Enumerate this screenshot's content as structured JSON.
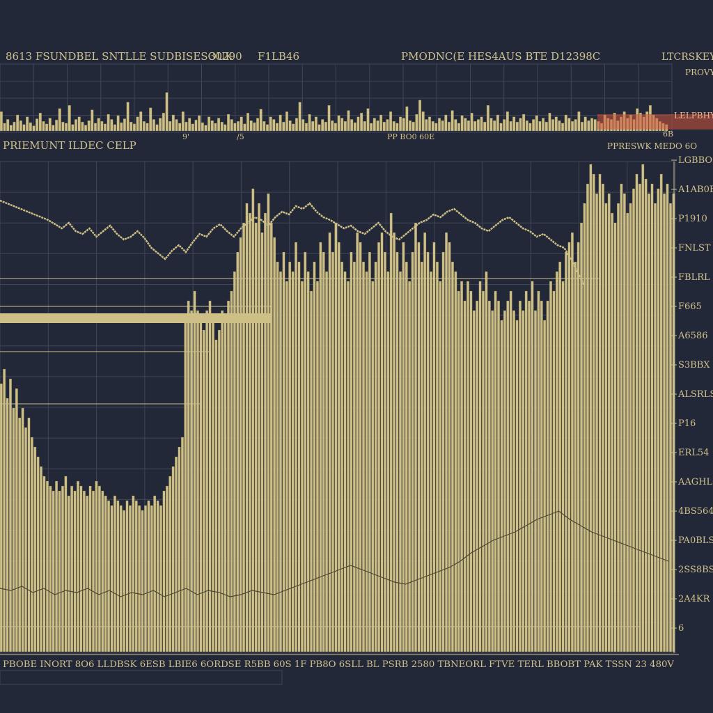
{
  "header": {
    "left": "8613 FSUNDBEL SNTLLE  SUDBISESOUK",
    "center_left": "30290",
    "center_mid": "F1LB46",
    "center_right": "PMODNC(E  HES4AUS  BTE  D12398C",
    "right": "LTCRSKEY"
  },
  "upper_panel": {
    "bottom_labels": [
      "9'",
      "/5",
      "PP BO0 60E",
      "6B"
    ],
    "right_labels": [
      "PROVY",
      "LELPBHY"
    ],
    "section_title": "PRIEMUNT ILDEC CELP",
    "section_right": "PPRESWK MEDO 6O"
  },
  "price_axis": {
    "labels": [
      "LGBBO",
      "A1AB0B",
      "P1910",
      "FNLST",
      "FBLRL",
      "F665",
      "A6586",
      "S3BBX",
      "ALSRLS",
      "P16",
      "ERL54",
      "AAGHLC",
      "4BS564",
      "PA0BLS",
      "2SS8BS",
      "2A4KR",
      "6"
    ]
  },
  "bottom_labels": "PBOBE INORT 8O6  LLDBSK 6ESB LBIE6 6ORDSE  R5BB 60S 1F PB8O  6SLL BL  PSRB 2580  TBNEORL  FTVE  TERL BBOBT  PAK  TSSN 23 480V",
  "colors": {
    "background": "#232838",
    "bar": "#cdbf86",
    "bar_edge": "#6f6848",
    "grid": "#3f4659",
    "text": "#cfc28f",
    "accent_red": "#d0543a"
  },
  "chart_data": [
    {
      "type": "bar",
      "title": "",
      "xlabel": "",
      "ylabel": "",
      "ylim": [
        0,
        100
      ],
      "bar_count": 220,
      "grid": true,
      "values": [
        30,
        12,
        18,
        9,
        14,
        25,
        16,
        10,
        22,
        13,
        8,
        19,
        28,
        15,
        11,
        20,
        9,
        17,
        35,
        14,
        12,
        40,
        10,
        18,
        22,
        14,
        9,
        16,
        33,
        12,
        20,
        15,
        11,
        26,
        18,
        10,
        24,
        13,
        19,
        45,
        14,
        11,
        22,
        30,
        15,
        12,
        36,
        18,
        10,
        20,
        28,
        60,
        15,
        25,
        18,
        12,
        30,
        14,
        20,
        11,
        17,
        24,
        13,
        9,
        22,
        16,
        12,
        20,
        14,
        10,
        26,
        18,
        12,
        15,
        22,
        11,
        28,
        16,
        13,
        20,
        34,
        15,
        10,
        22,
        18,
        12,
        25,
        14,
        30,
        16,
        11,
        20,
        45,
        18,
        12,
        26,
        15,
        22,
        10,
        18,
        14,
        40,
        16,
        12,
        24,
        20,
        15,
        32,
        18,
        13,
        22,
        28,
        15,
        35,
        12,
        20,
        16,
        25,
        14,
        18,
        30,
        15,
        12,
        22,
        20,
        38,
        16,
        14,
        26,
        48,
        30,
        18,
        22,
        15,
        12,
        20,
        16,
        25,
        14,
        32,
        18,
        12,
        24,
        20,
        16,
        28,
        15,
        18,
        22,
        14,
        40,
        20,
        16,
        25,
        12,
        18,
        30,
        15,
        22,
        14,
        20,
        26,
        16,
        12,
        18,
        24,
        15,
        20,
        14,
        28,
        18,
        22,
        16,
        12,
        25,
        20,
        15,
        18,
        30,
        14,
        22,
        16,
        20,
        18,
        15,
        12,
        25,
        20,
        18,
        28,
        16,
        22,
        30,
        20,
        25,
        18,
        35,
        28,
        22,
        30,
        40,
        25,
        20,
        15,
        12,
        10
      ]
    },
    {
      "type": "line",
      "title": "",
      "xlabel": "",
      "ylabel": "",
      "ylim": [
        0,
        100
      ],
      "values": [
        72,
        70,
        68,
        66,
        64,
        62,
        60,
        58,
        55,
        52,
        56,
        50,
        48,
        52,
        46,
        50,
        54,
        48,
        44,
        46,
        50,
        45,
        38,
        34,
        30,
        36,
        40,
        35,
        42,
        48,
        46,
        52,
        55,
        50,
        46,
        52,
        56,
        60,
        58,
        54,
        60,
        64,
        62,
        68,
        66,
        70,
        64,
        60,
        58,
        55,
        52,
        54,
        50,
        48,
        52,
        56,
        50,
        46,
        44,
        48,
        52,
        56,
        58,
        62,
        60,
        64,
        66,
        62,
        58,
        56,
        52,
        50,
        54,
        58,
        60,
        56,
        52,
        50,
        46,
        48,
        44,
        40,
        38,
        30,
        20,
        10
      ]
    },
    {
      "type": "bar",
      "title": "",
      "xlabel": "",
      "ylabel": "",
      "ylim": [
        0,
        100
      ],
      "bar_count": 220,
      "grid": true,
      "values": [
        55,
        58,
        52,
        56,
        50,
        54,
        48,
        50,
        46,
        48,
        44,
        42,
        40,
        38,
        36,
        35,
        34,
        33,
        35,
        33,
        34,
        36,
        32,
        34,
        33,
        35,
        34,
        33,
        32,
        34,
        33,
        35,
        34,
        33,
        32,
        31,
        30,
        32,
        31,
        30,
        29,
        31,
        30,
        32,
        31,
        30,
        29,
        30,
        31,
        30,
        32,
        31,
        30,
        33,
        34,
        36,
        38,
        40,
        42,
        44,
        68,
        72,
        70,
        74,
        70,
        68,
        66,
        70,
        72,
        68,
        64,
        66,
        70,
        68,
        72,
        74,
        78,
        82,
        85,
        88,
        92,
        90,
        95,
        88,
        92,
        86,
        90,
        94,
        88,
        85,
        80,
        78,
        82,
        76,
        80,
        78,
        84,
        80,
        76,
        82,
        78,
        74,
        80,
        76,
        84,
        82,
        78,
        86,
        82,
        88,
        84,
        80,
        78,
        76,
        82,
        80,
        86,
        84,
        80,
        78,
        82,
        76,
        80,
        84,
        86,
        82,
        78,
        90,
        86,
        82,
        78,
        84,
        80,
        76,
        82,
        88,
        84,
        80,
        86,
        82,
        78,
        84,
        80,
        76,
        82,
        86,
        84,
        80,
        78,
        74,
        76,
        72,
        76,
        74,
        70,
        72,
        76,
        74,
        78,
        72,
        70,
        74,
        72,
        68,
        70,
        72,
        74,
        70,
        68,
        72,
        70,
        74,
        72,
        76,
        70,
        74,
        72,
        68,
        72,
        76,
        74,
        78,
        80,
        76,
        82,
        84,
        86,
        80,
        84,
        88,
        92,
        96,
        100,
        98,
        94,
        98,
        96,
        92,
        94,
        90,
        88,
        92,
        96,
        94,
        90,
        92,
        95,
        98,
        96,
        100,
        97,
        94,
        96,
        92,
        95,
        98,
        94,
        96,
        92,
        94
      ]
    },
    {
      "type": "line",
      "title": "",
      "xlabel": "",
      "ylabel": "",
      "ylim": [
        0,
        100
      ],
      "values": [
        25,
        24,
        26,
        23,
        25,
        22,
        24,
        23,
        25,
        22,
        24,
        21,
        23,
        22,
        24,
        21,
        23,
        25,
        22,
        24,
        23,
        21,
        22,
        24,
        23,
        22,
        24,
        26,
        28,
        30,
        32,
        34,
        36,
        34,
        32,
        30,
        28,
        27,
        29,
        31,
        33,
        35,
        38,
        42,
        45,
        48,
        50,
        52,
        55,
        58,
        60,
        62,
        58,
        55,
        52,
        50,
        48,
        46,
        44,
        42,
        40,
        38
      ]
    }
  ]
}
